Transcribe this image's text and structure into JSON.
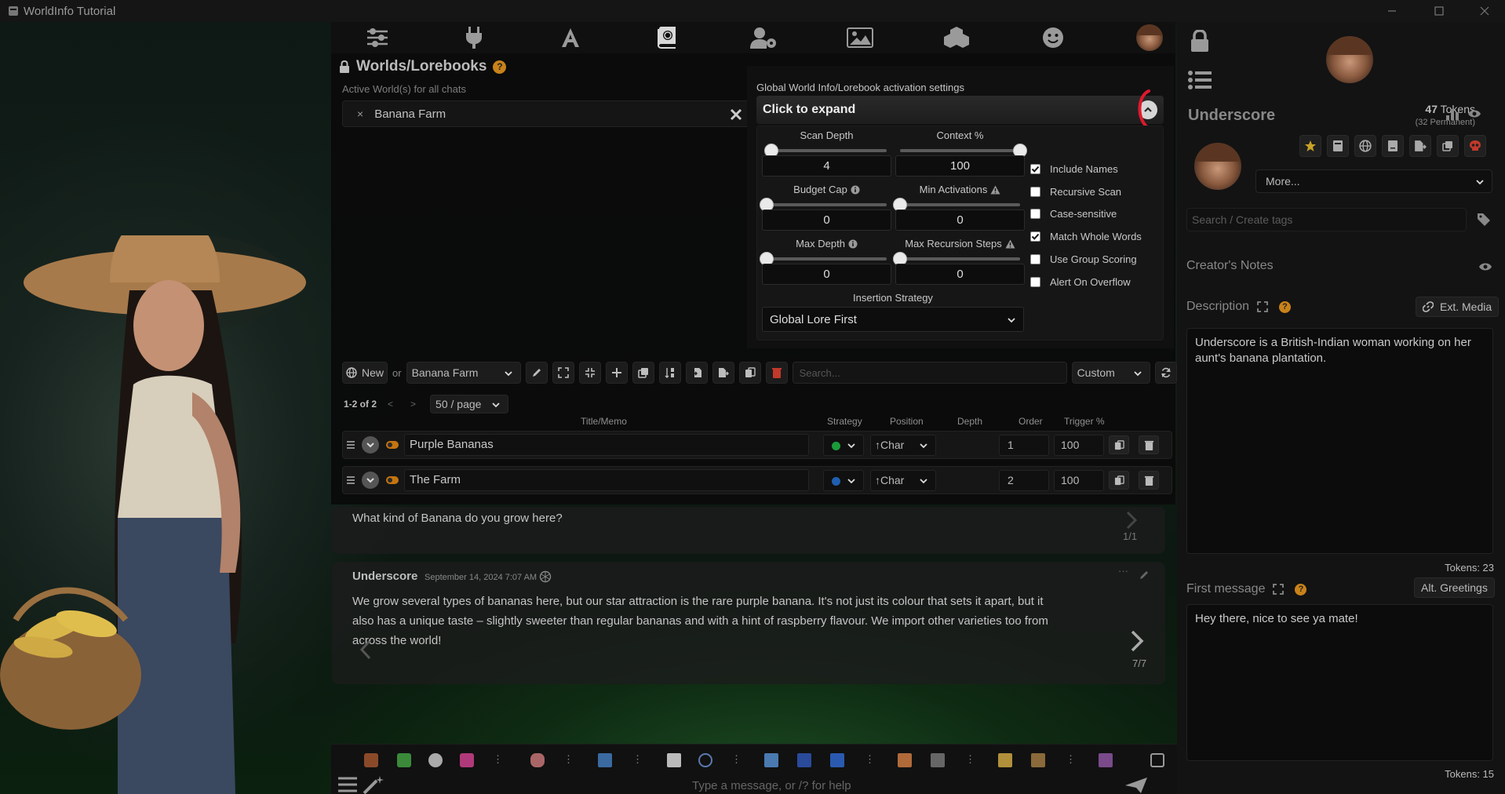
{
  "window": {
    "title": "WorldInfo Tutorial"
  },
  "worlds": {
    "title": "Worlds/Lorebooks",
    "help": "?",
    "active_label": "Active World(s) for all chats",
    "active_world": "Banana Farm",
    "chip_remove": "×"
  },
  "global": {
    "title": "Global World Info/Lorebook activation settings",
    "expand_label": "Click to expand",
    "scan_depth": {
      "label": "Scan Depth",
      "value": "4",
      "fill": 0.04
    },
    "context": {
      "label": "Context %",
      "value": "100",
      "fill": 1.0
    },
    "budget_cap": {
      "label": "Budget Cap",
      "value": "0",
      "fill": 0
    },
    "min_activations": {
      "label": "Min Activations",
      "value": "0",
      "fill": 0
    },
    "max_depth": {
      "label": "Max Depth",
      "value": "0",
      "fill": 0
    },
    "max_recursion": {
      "label": "Max Recursion Steps",
      "value": "0",
      "fill": 0
    },
    "checks": [
      {
        "label": "Include Names",
        "checked": true
      },
      {
        "label": "Recursive Scan",
        "checked": false
      },
      {
        "label": "Case-sensitive",
        "checked": false
      },
      {
        "label": "Match Whole Words",
        "checked": true
      },
      {
        "label": "Use Group Scoring",
        "checked": false
      },
      {
        "label": "Alert On Overflow",
        "checked": false
      }
    ],
    "insertion_label": "Insertion Strategy",
    "insertion_value": "Global Lore First"
  },
  "editor": {
    "new_label": "New",
    "or_label": "or",
    "book": "Banana Farm",
    "search_placeholder": "Search...",
    "sort": "Custom",
    "pager_count": "1-2 of 2",
    "prev": "<",
    "next": ">",
    "per_page": "50 / page",
    "columns": {
      "title": "Title/Memo",
      "strategy": "Strategy",
      "position": "Position",
      "depth": "Depth",
      "order": "Order",
      "trigger": "Trigger %"
    },
    "entries": [
      {
        "title": "Purple Bananas",
        "strategy_color": "#1a9a3a",
        "position": "↑Char",
        "order": "1",
        "trigger": "100"
      },
      {
        "title": "The Farm",
        "strategy_color": "#1f5fb0",
        "position": "↑Char",
        "order": "2",
        "trigger": "100"
      }
    ]
  },
  "chat": {
    "user_message": "What kind of Banana do you grow here?",
    "user_swipe": "1/1",
    "bot_name": "Underscore",
    "bot_date": "September 14, 2024 7:07 AM",
    "bot_lines": [
      "We grow several types of bananas here, but our star attraction is the rare purple banana. It's not just its colour that sets it apart, but it",
      "also has a unique taste – slightly sweeter than regular bananas and with a hint of raspberry flavour. We import other varieties too from",
      "across the world!"
    ],
    "bot_swipe": "7/7",
    "input_placeholder": "Type a message, or /? for help"
  },
  "character": {
    "name": "Underscore",
    "tokens_count": "47",
    "tokens_word": "Tokens",
    "tokens_perm": "(32 Permanent)",
    "more_label": "More...",
    "tag_placeholder": "Search / Create tags",
    "creators_notes": "Creator's Notes",
    "description_label": "Description",
    "ext_media": "Ext. Media",
    "description": "Underscore is a British-Indian woman working on her aunt's banana plantation.",
    "desc_tokens": "Tokens: 23",
    "first_message_label": "First message",
    "alt_greetings": "Alt. Greetings",
    "first_message": "Hey there, nice to see ya mate!",
    "first_tokens": "Tokens: 15"
  },
  "colors": {
    "accent": "#c9821a",
    "highlight_red": "#e0182d",
    "toggle": "#c47410"
  }
}
